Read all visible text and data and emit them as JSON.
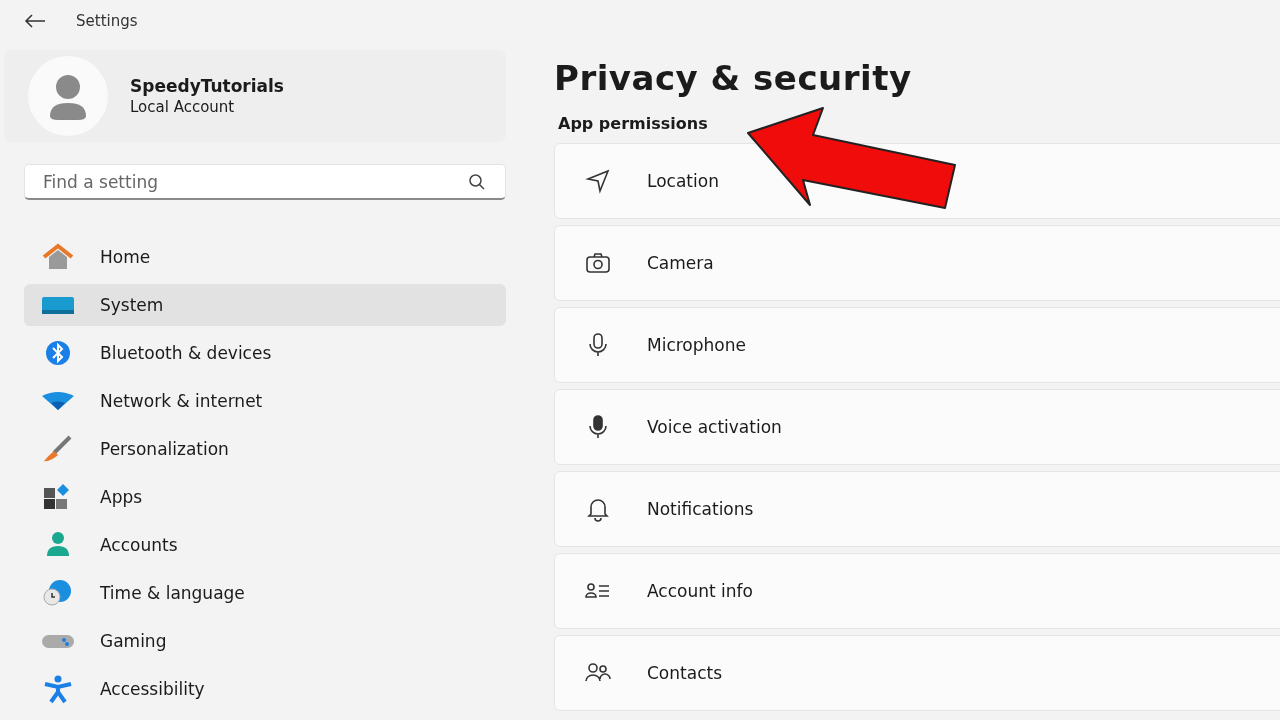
{
  "window": {
    "title": "Settings"
  },
  "account": {
    "name": "SpeedyTutorials",
    "type": "Local Account"
  },
  "search": {
    "placeholder": "Find a setting"
  },
  "sidebar": {
    "items": [
      {
        "label": "Home",
        "highlighted": false
      },
      {
        "label": "System",
        "highlighted": true
      },
      {
        "label": "Bluetooth & devices",
        "highlighted": false
      },
      {
        "label": "Network & internet",
        "highlighted": false
      },
      {
        "label": "Personalization",
        "highlighted": false
      },
      {
        "label": "Apps",
        "highlighted": false
      },
      {
        "label": "Accounts",
        "highlighted": false
      },
      {
        "label": "Time & language",
        "highlighted": false
      },
      {
        "label": "Gaming",
        "highlighted": false
      },
      {
        "label": "Accessibility",
        "highlighted": false
      }
    ]
  },
  "page": {
    "title": "Privacy & security",
    "section": "App permissions",
    "items": [
      {
        "label": "Location"
      },
      {
        "label": "Camera"
      },
      {
        "label": "Microphone"
      },
      {
        "label": "Voice activation"
      },
      {
        "label": "Notifications"
      },
      {
        "label": "Account info"
      },
      {
        "label": "Contacts"
      }
    ]
  }
}
